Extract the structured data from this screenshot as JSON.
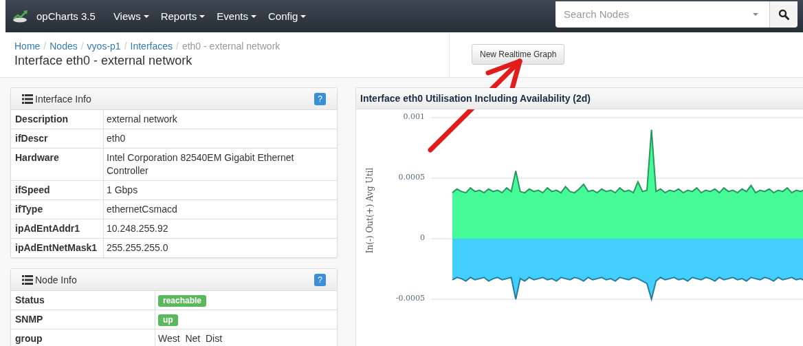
{
  "navbar": {
    "brand": "opCharts 3.5",
    "menus": [
      {
        "label": "Views"
      },
      {
        "label": "Reports"
      },
      {
        "label": "Events"
      },
      {
        "label": "Config"
      }
    ],
    "search": {
      "placeholder": "Search Nodes"
    }
  },
  "breadcrumb": [
    {
      "label": "Home",
      "link": true
    },
    {
      "separator": "/",
      "label": "Nodes",
      "link": true
    },
    {
      "separator": "/",
      "label": "vyos-p1",
      "link": true
    },
    {
      "separator": "/",
      "label": "Interfaces",
      "link": true
    },
    {
      "separator": "/",
      "label": "eth0 - external network",
      "link": false
    }
  ],
  "page_title": "Interface eth0 - external network",
  "realtime_button": "New Realtime Graph",
  "interface_info": {
    "title": "Interface Info",
    "help": "?",
    "rows": [
      {
        "label": "Description",
        "value": "external network"
      },
      {
        "label": "ifDescr",
        "value": "eth0"
      },
      {
        "label": "Hardware",
        "value": "Intel Corporation 82540EM Gigabit Ethernet Controller"
      },
      {
        "label": "ifSpeed",
        "value": "1 Gbps"
      },
      {
        "label": "ifType",
        "value": "ethernetCsmacd"
      },
      {
        "label": "ipAdEntAddr1",
        "value": "10.248.255.92"
      },
      {
        "label": "ipAdEntNetMask1",
        "value": "255.255.255.0"
      }
    ]
  },
  "node_info": {
    "title": "Node Info",
    "help": "?",
    "rows": [
      {
        "label": "Status",
        "value": "reachable",
        "kind": "badge"
      },
      {
        "label": "SNMP",
        "value": "up",
        "kind": "badge"
      },
      {
        "label": "group",
        "value": "West  Net  Dist",
        "kind": "text"
      }
    ]
  },
  "graph": {
    "title": "Interface eth0 Utilisation Including Availability (2d)",
    "chart_data": {
      "type": "area",
      "ylabel": "In(-) Out(+) Avg Util",
      "ylim": [
        -0.0005,
        0.001
      ],
      "grid": true,
      "yticks": [
        0.001,
        0.0005,
        0,
        -0.0005
      ],
      "series": [
        {
          "color": "#45fb98",
          "values": [
            0.00038,
            0.00041,
            0.00039,
            0.00038,
            0.00042,
            0.00039,
            0.0004,
            0.00038,
            0.00041,
            0.00039,
            0.0004,
            0.00038,
            0.00042,
            0.00039,
            0.00056,
            0.00039,
            0.00038,
            0.00041,
            0.00039,
            0.0004,
            0.00038,
            0.00042,
            0.00039,
            0.0004,
            0.00038,
            0.00043,
            0.00039,
            0.00038,
            0.00041,
            0.00045,
            0.00039,
            0.0004,
            0.00038,
            0.00041,
            0.00039,
            0.0004,
            0.00038,
            0.00042,
            0.00039,
            0.0004,
            0.00038,
            0.00047,
            0.00039,
            0.0004,
            0.0009,
            0.00039,
            0.00041,
            0.00038,
            0.0004,
            0.00039,
            0.00041,
            0.00038,
            0.0004,
            0.00039,
            0.00042,
            0.00038,
            0.0004,
            0.00039,
            0.00041,
            0.00038,
            0.00042,
            0.00039,
            0.0004,
            0.00038,
            0.00041,
            0.00039,
            0.00044,
            0.00038,
            0.0004,
            0.00039,
            0.00041,
            0.00038,
            0.0004,
            0.00039,
            0.00042,
            0.00038,
            0.0004,
            0.00039,
            0.00041,
            0.00039
          ]
        },
        {
          "color": "#42cfff",
          "values": [
            -0.00034,
            -0.00032,
            -0.00033,
            -0.00035,
            -0.00032,
            -0.00034,
            -0.00033,
            -0.00032,
            -0.00035,
            -0.00033,
            -0.00032,
            -0.00034,
            -0.00033,
            -0.00032,
            -0.0005,
            -0.00033,
            -0.00035,
            -0.00032,
            -0.00034,
            -0.00033,
            -0.00032,
            -0.00034,
            -0.00033,
            -0.00035,
            -0.00032,
            -0.00033,
            -0.00034,
            -0.00032,
            -0.00033,
            -0.00035,
            -0.00032,
            -0.00034,
            -0.00033,
            -0.00032,
            -0.00034,
            -0.00033,
            -0.00035,
            -0.00032,
            -0.00033,
            -0.00034,
            -0.00032,
            -0.00033,
            -0.00035,
            -0.00037,
            -0.0005,
            -0.00035,
            -0.00032,
            -0.00034,
            -0.00033,
            -0.00032,
            -0.00034,
            -0.00033,
            -0.00035,
            -0.00032,
            -0.00033,
            -0.00034,
            -0.00032,
            -0.00033,
            -0.00035,
            -0.00032,
            -0.00034,
            -0.00033,
            -0.00032,
            -0.00034,
            -0.00033,
            -0.00035,
            -0.00032,
            -0.00033,
            -0.00034,
            -0.00032,
            -0.00033,
            -0.00035,
            -0.00032,
            -0.00034,
            -0.00033,
            -0.00032,
            -0.00034,
            -0.00033,
            -0.00035,
            -0.00033
          ]
        }
      ]
    }
  }
}
